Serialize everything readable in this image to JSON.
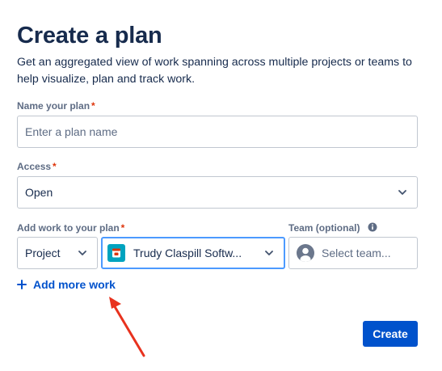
{
  "page": {
    "title": "Create a plan",
    "description": "Get an aggregated view of work spanning across multiple projects or teams to help visualize, plan and track work."
  },
  "name_field": {
    "label": "Name your plan",
    "required_mark": "*",
    "placeholder": "Enter a plan name",
    "value": ""
  },
  "access_field": {
    "label": "Access",
    "required_mark": "*",
    "value": "Open"
  },
  "work_field": {
    "label": "Add work to your plan",
    "required_mark": "*",
    "type_value": "Project",
    "source_value": "Trudy Claspill Softw...",
    "source_icon": "project-app-icon"
  },
  "team_field": {
    "label": "Team (optional)",
    "placeholder": "Select team...",
    "icon": "info-icon"
  },
  "actions": {
    "add_more_label": "Add more work",
    "create_label": "Create"
  },
  "colors": {
    "primary": "#0052cc",
    "focus": "#4c9aff",
    "required": "#de350b",
    "annotation_arrow": "#e8321e"
  }
}
